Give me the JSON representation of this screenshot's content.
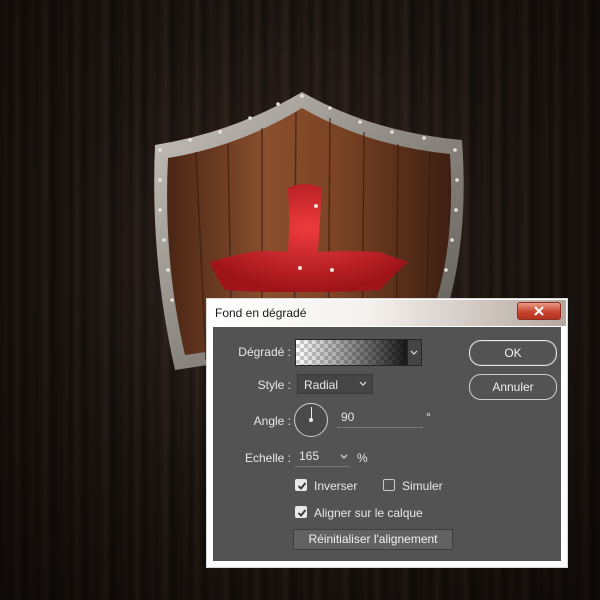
{
  "dialog": {
    "title": "Fond en dégradé",
    "fields": {
      "gradient_label": "Dégradé :",
      "style_label": "Style :",
      "style_value": "Radial",
      "angle_label": "Angle :",
      "angle_value": "90",
      "angle_unit": "°",
      "scale_label": "Echelle :",
      "scale_value": "165",
      "scale_unit": "%"
    },
    "options": {
      "reverse_label": "Inverser",
      "reverse_checked": true,
      "dither_label": "Simuler",
      "dither_checked": false,
      "align_label": "Aligner sur le calque",
      "align_checked": true
    },
    "buttons": {
      "ok": "OK",
      "cancel": "Annuler",
      "reset_alignment": "Réinitialiser l'alignement"
    }
  },
  "colors": {
    "panel": "#535353",
    "shield_red": "#c9262a",
    "wood": "#7a4326"
  }
}
